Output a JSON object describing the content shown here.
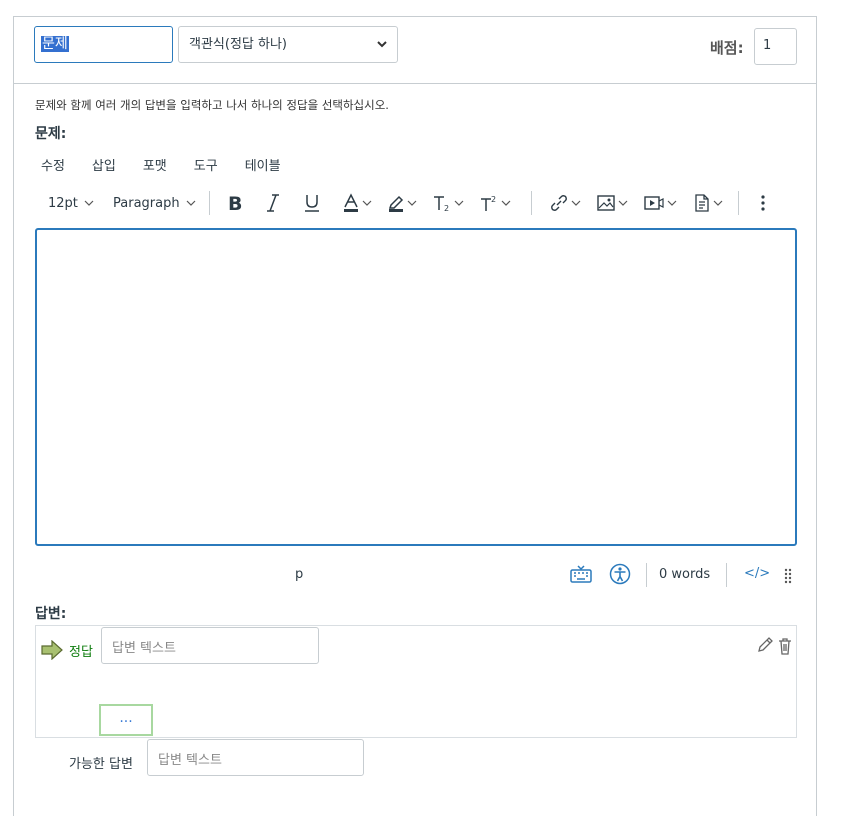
{
  "header": {
    "title_value_selected": "문제",
    "question_type": "객관식(정답 하나)",
    "points_label": "배점:",
    "points_value": "1"
  },
  "instructions": "문제와 함께 여러 개의 답변을 입력하고 나서 하나의 정답을 선택하십시오.",
  "question_label": "문제:",
  "menubar": [
    "수정",
    "삽입",
    "포맷",
    "도구",
    "테이블"
  ],
  "toolbar": {
    "font_size": "12pt",
    "block_format": "Paragraph",
    "icons": [
      "bold-icon",
      "italic-icon",
      "underline-icon",
      "text-color-icon",
      "highlight-icon",
      "subscript-icon",
      "superscript-icon",
      "link-icon",
      "image-icon",
      "media-icon",
      "document-icon",
      "more-icon"
    ]
  },
  "status": {
    "path": "p",
    "word_count": "0 words",
    "html_toggle": "</>"
  },
  "answers_label": "답변:",
  "answers": [
    {
      "marker": "정답",
      "placeholder": "답변 텍스트"
    }
  ],
  "more_button": "...",
  "possible_answer": {
    "label": "가능한 답변",
    "placeholder": "답변 텍스트"
  },
  "colors": {
    "accent": "#2b7abc",
    "correct": "#0f7d0f",
    "border": "#c7cdd1"
  }
}
